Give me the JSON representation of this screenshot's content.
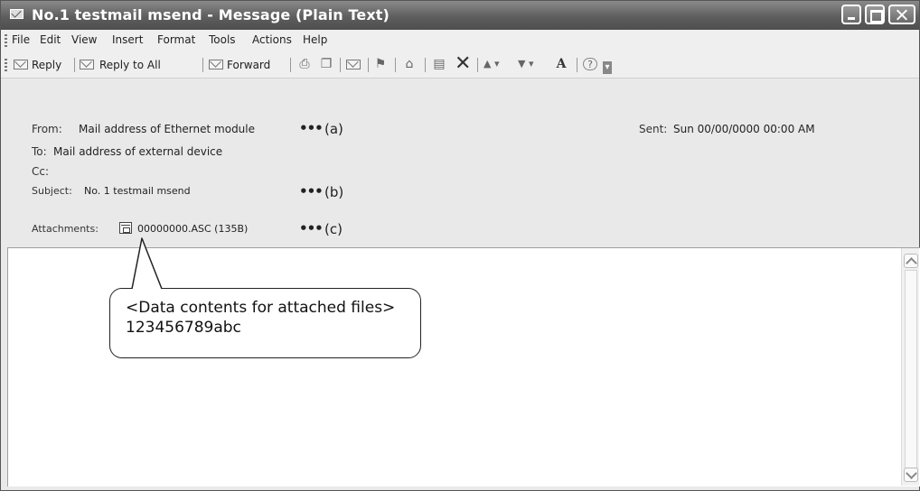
{
  "window": {
    "title": "No.1 testmail msend - Message (Plain Text)",
    "icon": "envelope-icon"
  },
  "menu": [
    {
      "label": "File"
    },
    {
      "label": "Edit"
    },
    {
      "label": "View"
    },
    {
      "label": "Insert"
    },
    {
      "label": "Format"
    },
    {
      "label": "Tools"
    },
    {
      "label": "Actions"
    },
    {
      "label": "Help"
    }
  ],
  "toolbar": {
    "reply_label": "Reply",
    "reply_all_label": "Reply to All",
    "forward_label": "Forward",
    "icons": [
      "reply-icon",
      "reply-all-icon",
      "forward-icon",
      "print-icon",
      "copy-icon",
      "move-icon",
      "flag-icon",
      "categorize-icon",
      "save-icon",
      "delete-icon",
      "previous-icon",
      "next-icon",
      "font-size-icon",
      "help-icon"
    ]
  },
  "header": {
    "from_label": "From:",
    "from_value": "Mail address of Ethernet module",
    "to_label": "To:",
    "to_value": "Mail address of external device",
    "cc_label": "Cc:",
    "subject_label": "Subject:",
    "subject_value": "No. 1 testmail msend",
    "attachments_label": "Attachments:",
    "attachment_value": "00000000.ASC (135B)",
    "sent_label": "Sent:",
    "sent_value": "Sun 00/00/0000 00:00 AM"
  },
  "annotations": {
    "dots": "•••",
    "a": "(a)",
    "b": "(b)",
    "c": "(c)"
  },
  "callout": {
    "line1": "<Data contents for attached files>",
    "line2": "123456789abc"
  }
}
